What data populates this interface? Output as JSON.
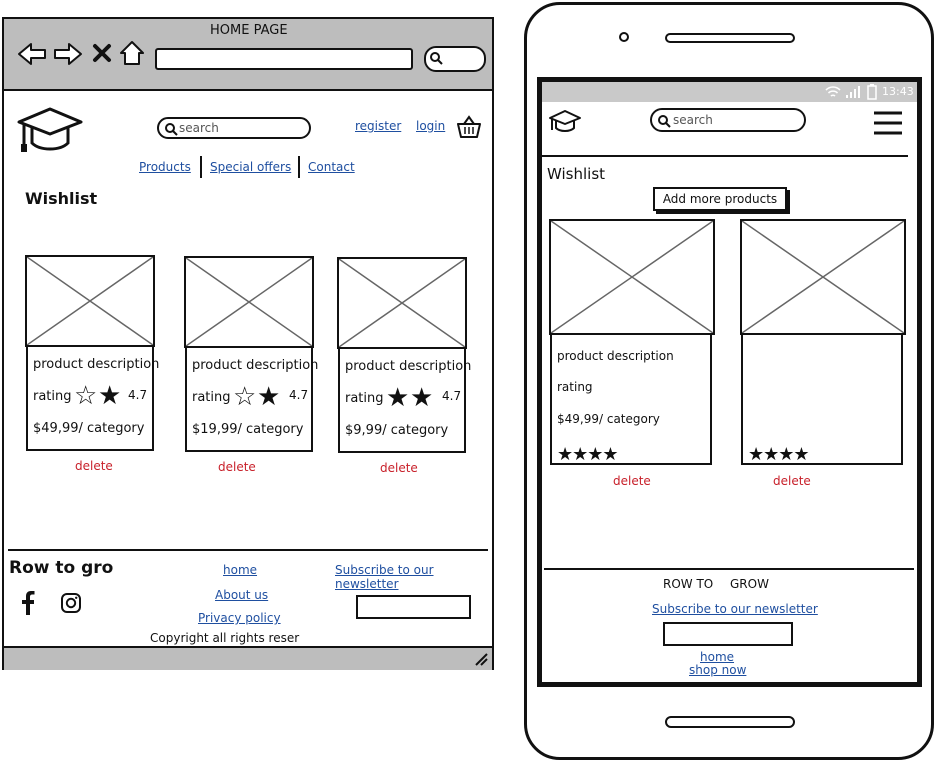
{
  "desktop": {
    "window_title": "HOME PAGE",
    "search_placeholder": "search",
    "register": "register",
    "login": "login",
    "nav": [
      "Products",
      "Special offers",
      "Contact"
    ],
    "heading": "Wishlist",
    "products": [
      {
        "description": "product description",
        "rating_label": "rating",
        "rating": "4.7",
        "price": "$49,99/ category",
        "delete": "delete"
      },
      {
        "description": "product description",
        "rating_label": "rating",
        "rating": "4.7",
        "price": "$19,99/ category",
        "delete": "delete"
      },
      {
        "description": "product description",
        "rating_label": "rating",
        "rating": "4.7",
        "price": "$9,99/ category",
        "delete": "delete"
      }
    ],
    "footer": {
      "brand": "Row to gro",
      "links": [
        "home",
        "About us",
        "Privacy policy"
      ],
      "newsletter": "Subscribe to our newsletter",
      "copyright": "Copyright all rights reser"
    }
  },
  "mobile": {
    "time": "13:43",
    "search_placeholder": "search",
    "heading": "Wishlist",
    "add_button": "Add more products",
    "product": {
      "description": "product description",
      "rating_label": "rating",
      "price": "$49,99/ category"
    },
    "delete": "delete",
    "footer": {
      "brand_a": "ROW TO",
      "brand_b": "GROW",
      "newsletter": "Subscribe to our newsletter",
      "links": [
        "home",
        "shop now"
      ]
    }
  }
}
